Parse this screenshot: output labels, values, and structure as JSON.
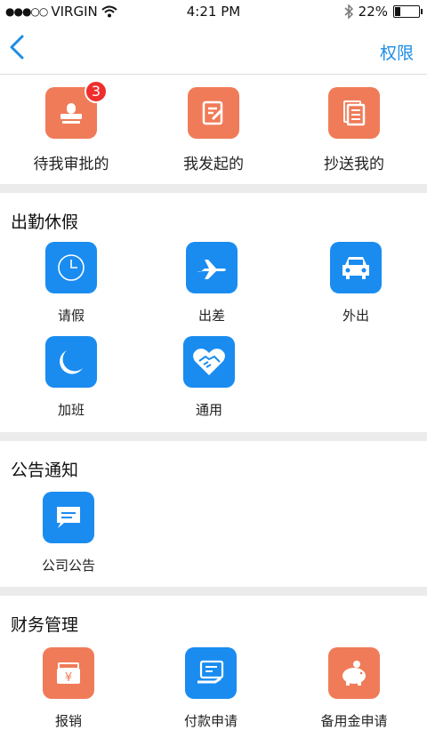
{
  "status": {
    "carrier": "VIRGIN",
    "time": "4:21 PM",
    "battery": "22%",
    "battery_level": 0.22
  },
  "nav": {
    "back_icon": "chevron-left-icon",
    "action": "权限"
  },
  "top": [
    {
      "label": "待我审批的",
      "icon": "stamp-icon",
      "badge": "3"
    },
    {
      "label": "我发起的",
      "icon": "edit-document-icon"
    },
    {
      "label": "抄送我的",
      "icon": "copy-documents-icon"
    }
  ],
  "leave": {
    "title": "出勤休假",
    "items": [
      {
        "label": "请假",
        "icon": "clock-icon"
      },
      {
        "label": "出差",
        "icon": "airplane-icon"
      },
      {
        "label": "外出",
        "icon": "car-icon"
      },
      {
        "label": "加班",
        "icon": "moon-icon"
      },
      {
        "label": "通用",
        "icon": "handshake-icon"
      }
    ]
  },
  "notice": {
    "title": "公告通知",
    "items": [
      {
        "label": "公司公告",
        "icon": "message-icon"
      }
    ]
  },
  "finance": {
    "title": "财务管理",
    "items": [
      {
        "label": "报销",
        "icon": "yuan-wallet-icon"
      },
      {
        "label": "付款申请",
        "icon": "payment-card-icon"
      },
      {
        "label": "备用金申请",
        "icon": "piggy-bank-icon"
      }
    ]
  }
}
